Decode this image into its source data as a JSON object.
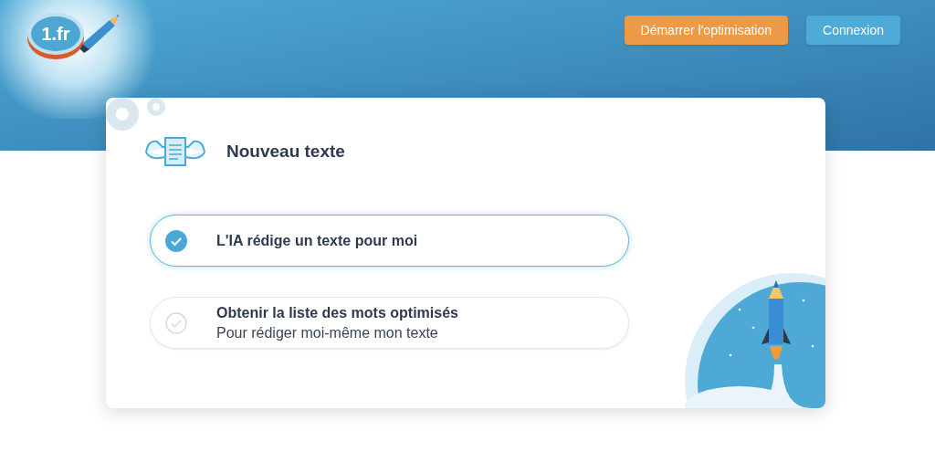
{
  "header": {
    "logo_text": "1.fr",
    "buttons": [
      {
        "label": "Démarrer l'optimisation",
        "kind": "primary"
      },
      {
        "label": "Connexion",
        "kind": "secondary"
      }
    ]
  },
  "card": {
    "title": "Nouveau texte",
    "options": [
      {
        "title": "L'IA rédige un texte pour moi",
        "selected": true
      },
      {
        "title": "Obtenir la liste des mots optimisés",
        "subtitle": "Pour rédiger moi-même mon texte",
        "selected": false
      }
    ]
  }
}
